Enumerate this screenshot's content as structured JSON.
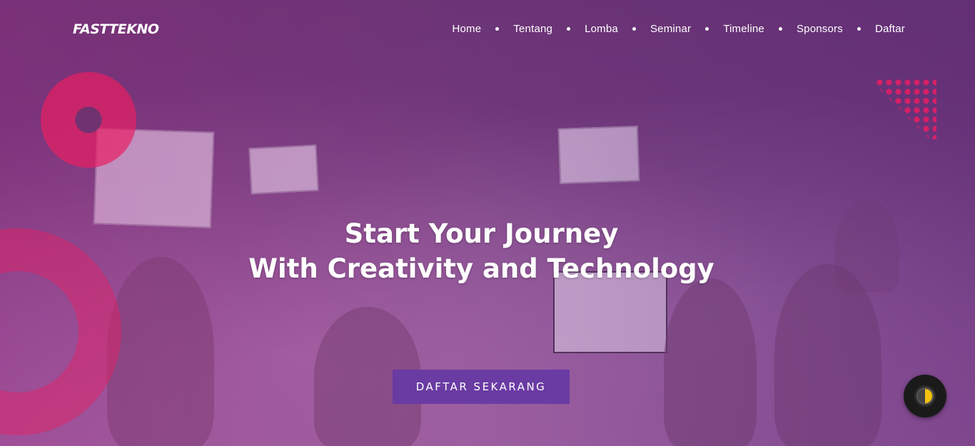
{
  "brand": {
    "logo_text": "FASTTEKNO"
  },
  "nav": {
    "items": [
      {
        "label": "Home"
      },
      {
        "label": "Tentang"
      },
      {
        "label": "Lomba"
      },
      {
        "label": "Seminar"
      },
      {
        "label": "Timeline"
      },
      {
        "label": "Sponsors"
      },
      {
        "label": "Daftar"
      }
    ]
  },
  "hero": {
    "title_line1": "Start Your Journey",
    "title_line2": "With Creativity and Technology",
    "cta_label": "DAFTAR SEKARANG"
  },
  "colors": {
    "accent": "#e91e63",
    "cta_bg": "#6a3ba3",
    "overlay": "#7a3b7e"
  },
  "icons": {
    "theme_toggle": "half-moon-icon"
  }
}
